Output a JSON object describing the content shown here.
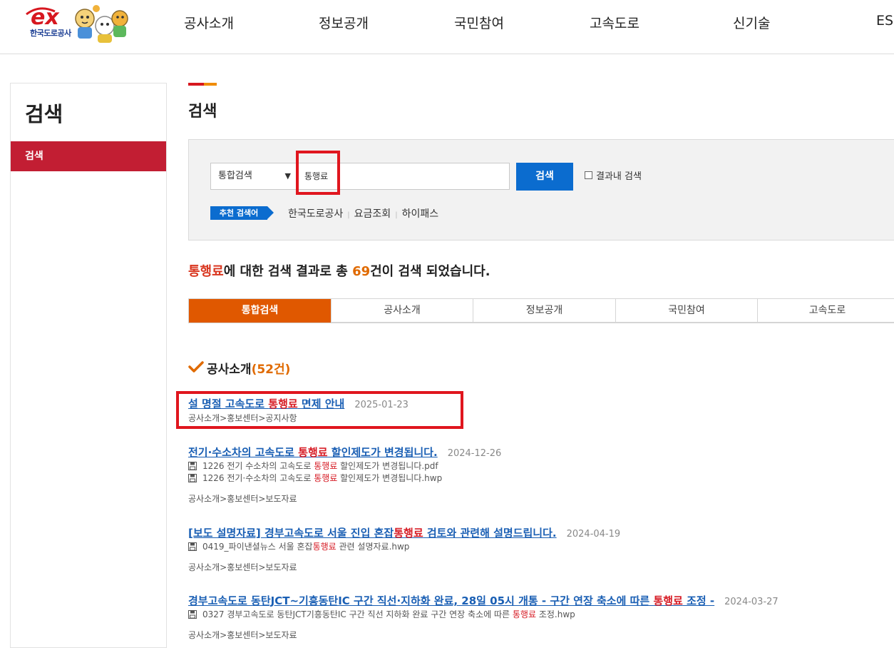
{
  "header": {
    "logo_text": "ex",
    "logo_sub": "한국도로공사",
    "nav": [
      "공사소개",
      "정보공개",
      "국민참여",
      "고속도로",
      "신기술",
      "ESG"
    ]
  },
  "lnb": {
    "title": "검색",
    "items": [
      {
        "label": "검색"
      }
    ]
  },
  "page_title": "검색",
  "search": {
    "scope": "통합검색",
    "query": "통행료",
    "button": "검색",
    "within_label": "결과내 검색",
    "recommend_label": "추천 검색어",
    "recommend": [
      "한국도로공사",
      "요금조회",
      "하이패스"
    ]
  },
  "summary": {
    "keyword": "통행료",
    "mid": "에 대한 검색 결과로 총 ",
    "count": "69",
    "tail": "건이 검색 되었습니다."
  },
  "tabs": [
    "통합검색",
    "공사소개",
    "정보공개",
    "국민참여",
    "고속도로"
  ],
  "section": {
    "title": "공사소개",
    "count": "(52건)"
  },
  "results": [
    {
      "title_pre": "설 명절 고속도로 ",
      "title_kw": "통행료",
      "title_post": " 면제 안내",
      "date": "2025-01-23",
      "files": [],
      "path": "공사소개>홍보센터>공지사항"
    },
    {
      "title_pre": "전기·수소차의 고속도로 ",
      "title_kw": "통행료",
      "title_post": " 할인제도가 변경됩니다.",
      "date": "2024-12-26",
      "files": [
        {
          "pre": "1226 전기 수소차의 고속도로 ",
          "kw": "통행료",
          "post": " 할인제도가 변경됩니다.pdf"
        },
        {
          "pre": "1226 전기·수소차의 고속도로 ",
          "kw": "통행료",
          "post": " 할인제도가 변경됩니다.hwp"
        }
      ],
      "path": "공사소개>홍보센터>보도자료"
    },
    {
      "title_pre": "[보도 설명자료] 경부고속도로 서울 진입 혼잡",
      "title_kw": "통행료",
      "title_post": " 검토와 관련해 설명드립니다.",
      "date": "2024-04-19",
      "files": [
        {
          "pre": "0419_파이낸셜뉴스 서울 혼잡",
          "kw": "통행료",
          "post": " 관련 설명자료.hwp"
        }
      ],
      "path": "공사소개>홍보센터>보도자료"
    },
    {
      "title_pre": "경부고속도로 동탄JCT~기흥동탄IC 구간 직선·지하화 완료, 28일 05시 개통 - 구간 연장 축소에 따른 ",
      "title_kw": "통행료",
      "title_post": " 조정 -",
      "date": "2024-03-27",
      "files": [
        {
          "pre": "0327 경부고속도로 동탄JCT기흥동탄IC 구간 직선 지하화 완료 구간 연장 축소에 따른 ",
          "kw": "통행료",
          "post": " 조정.hwp"
        }
      ],
      "path": "공사소개>홍보센터>보도자료"
    }
  ]
}
